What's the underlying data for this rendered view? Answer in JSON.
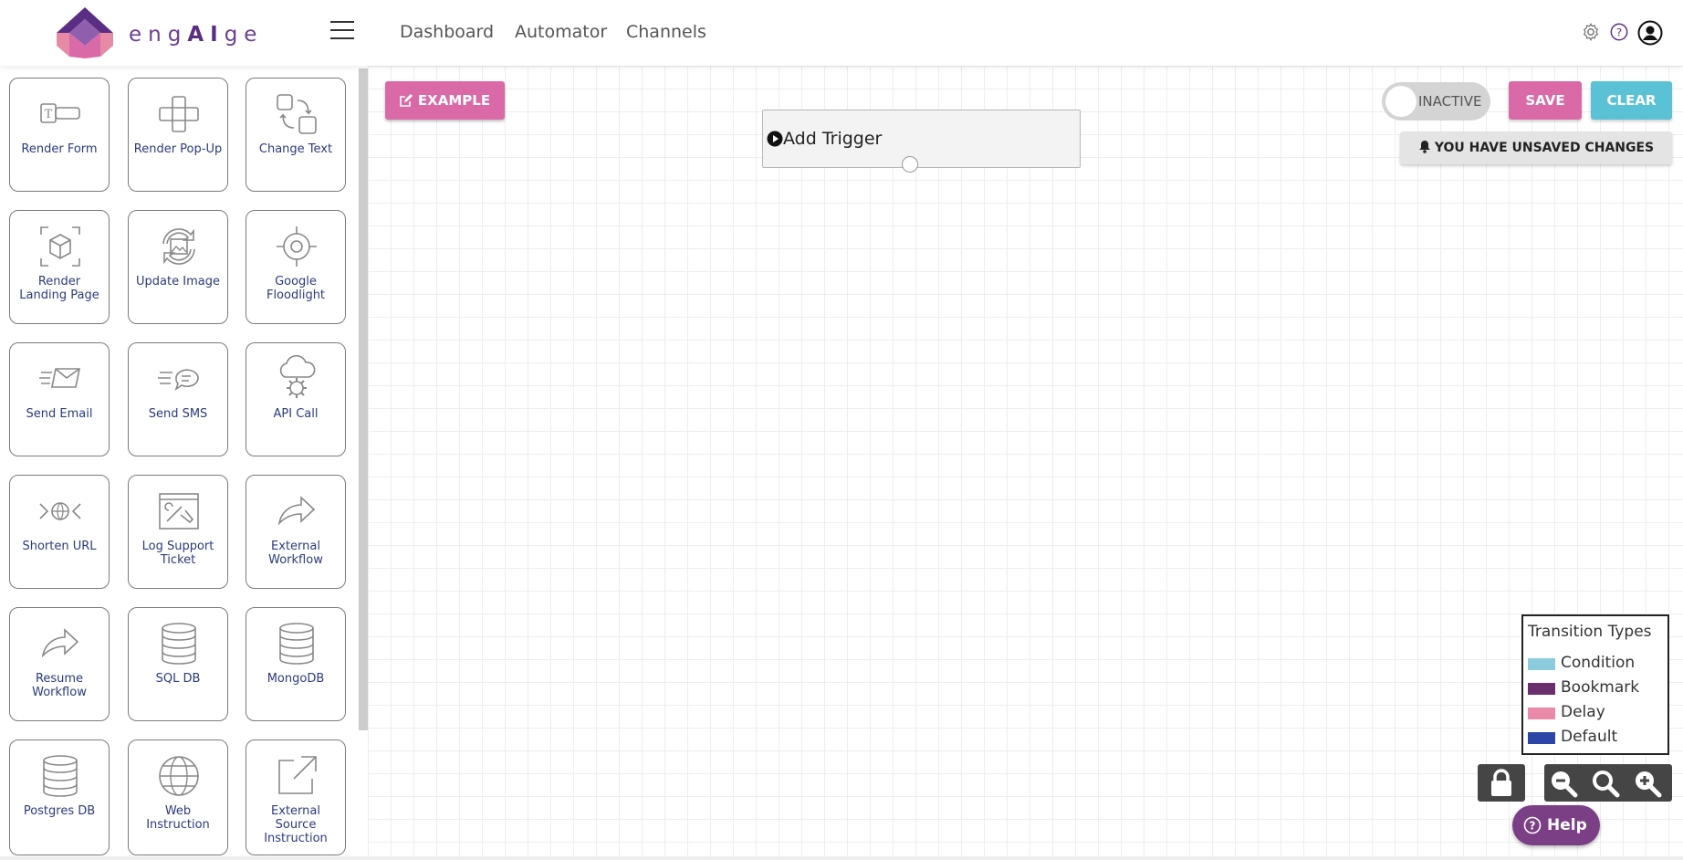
{
  "header": {
    "logo_text_pre": "eng",
    "logo_text_mid": "AI",
    "logo_text_post": "ge",
    "nav": [
      "Dashboard",
      "Automator",
      "Channels"
    ]
  },
  "sidebar": {
    "tiles": [
      {
        "label": "Render Form",
        "icon": "form-icon"
      },
      {
        "label": "Render Pop-Up",
        "icon": "popup-icon"
      },
      {
        "label": "Change Text",
        "icon": "change-text-icon"
      },
      {
        "label": "Render Landing Page",
        "icon": "landing-page-icon"
      },
      {
        "label": "Update Image",
        "icon": "update-image-icon"
      },
      {
        "label": "Google Floodlight",
        "icon": "floodlight-icon"
      },
      {
        "label": "Send Email",
        "icon": "email-icon"
      },
      {
        "label": "Send SMS",
        "icon": "sms-icon"
      },
      {
        "label": "API Call",
        "icon": "api-cloud-icon"
      },
      {
        "label": "Shorten URL",
        "icon": "globe-arrows-icon"
      },
      {
        "label": "Log Support Ticket",
        "icon": "support-ticket-icon"
      },
      {
        "label": "External Workflow",
        "icon": "forward-arrow-icon"
      },
      {
        "label": "Resume Workflow",
        "icon": "forward-arrow-icon"
      },
      {
        "label": "SQL DB",
        "icon": "database-icon"
      },
      {
        "label": "MongoDB",
        "icon": "database-icon"
      },
      {
        "label": "Postgres DB",
        "icon": "database-icon"
      },
      {
        "label": "Web Instruction",
        "icon": "globe-icon"
      },
      {
        "label": "External Source Instruction",
        "icon": "external-link-icon"
      }
    ]
  },
  "canvas": {
    "example_label": "EXAMPLE",
    "trigger_label": "Add Trigger",
    "toggle_label": "INACTIVE",
    "save_label": "SAVE",
    "clear_label": "CLEAR",
    "unsaved_label": "YOU HAVE UNSAVED CHANGES",
    "legend": {
      "title": "Transition Types",
      "items": [
        {
          "label": "Condition",
          "color": "#8ccbdc"
        },
        {
          "label": "Bookmark",
          "color": "#6b2f6e"
        },
        {
          "label": "Delay",
          "color": "#e88aa8"
        },
        {
          "label": "Default",
          "color": "#2c45a6"
        }
      ]
    },
    "help_label": "Help"
  },
  "colors": {
    "accent_pink": "#d96aa7",
    "accent_teal": "#5bc2d6",
    "brand_purple": "#6a3f8e"
  }
}
